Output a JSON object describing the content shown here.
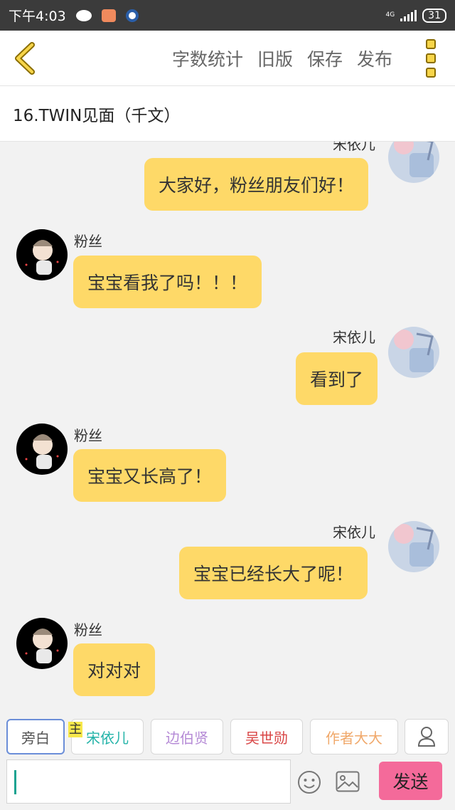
{
  "status_bar": {
    "time": "下午4:03",
    "network": "4G",
    "battery": "31"
  },
  "toolbar": {
    "actions": [
      "字数统计",
      "旧版",
      "保存",
      "发布"
    ]
  },
  "chapter_title": "16.TWIN见面（千文）",
  "messages": [
    {
      "side": "right",
      "name": "宋依儿",
      "text": "大家好，粉丝朋友们好！"
    },
    {
      "side": "left",
      "name": "粉丝",
      "text": "宝宝看我了吗！！！"
    },
    {
      "side": "right",
      "name": "宋依儿",
      "text": "看到了"
    },
    {
      "side": "left",
      "name": "粉丝",
      "text": "宝宝又长高了！"
    },
    {
      "side": "right",
      "name": "宋依儿",
      "text": "宝宝已经长大了呢！"
    },
    {
      "side": "left",
      "name": "粉丝",
      "text": "对对对"
    }
  ],
  "roles": [
    {
      "label": "旁白",
      "color": "#555555"
    },
    {
      "label": "宋依儿",
      "color": "#23b3a8"
    },
    {
      "label": "边伯贤",
      "color": "#b58ad6"
    },
    {
      "label": "吴世勋",
      "color": "#d94646"
    },
    {
      "label": "作者大大",
      "color": "#f0a86a"
    }
  ],
  "role_tag": "主",
  "send_label": "发送",
  "colors": {
    "bubble": "#fed968",
    "send": "#f46a9a",
    "accent": "#f7d54a"
  }
}
